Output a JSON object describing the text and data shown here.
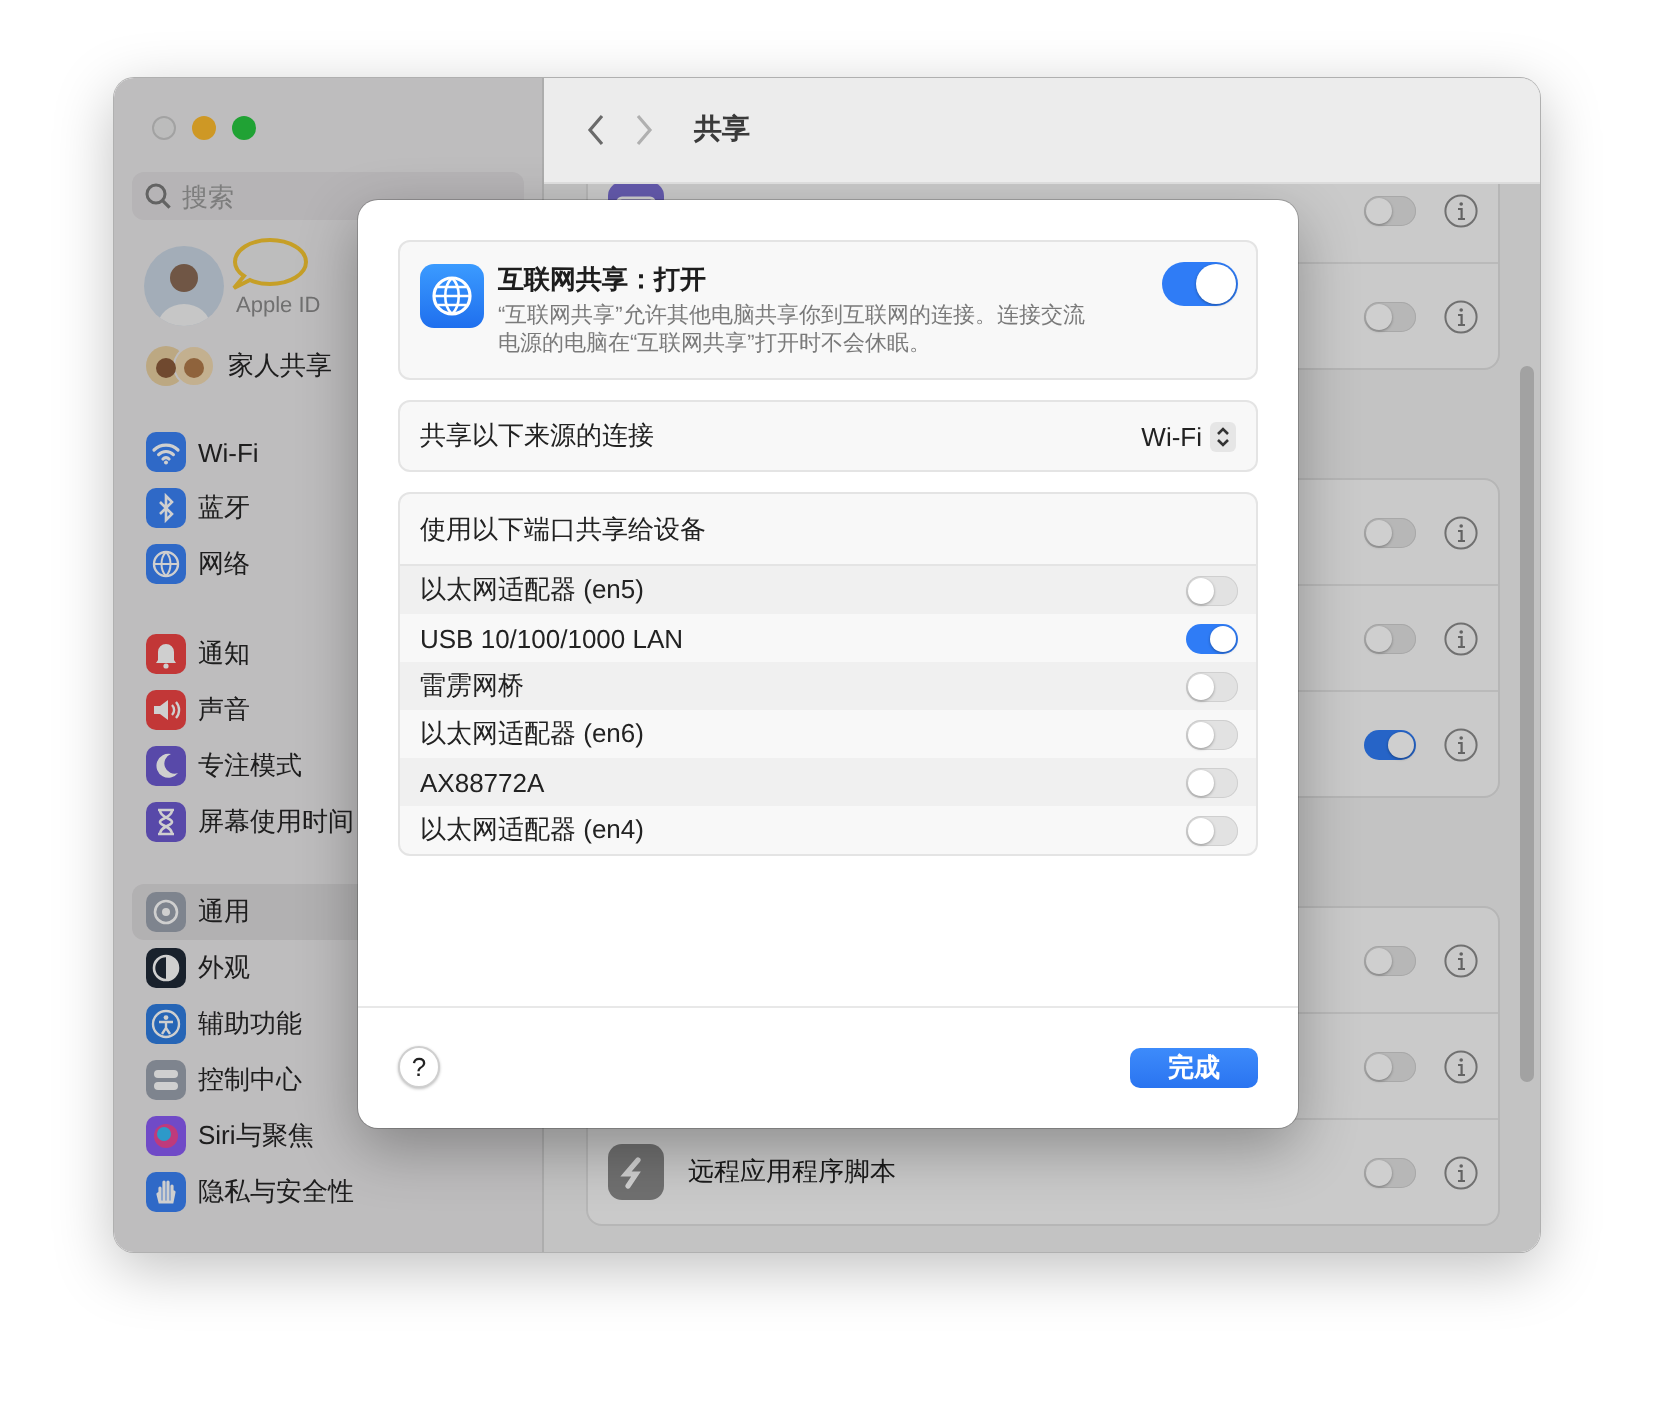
{
  "window": {
    "title": "共享"
  },
  "sidebar": {
    "search": {
      "placeholder": "搜索"
    },
    "account": {
      "label": "Apple ID"
    },
    "family": {
      "label": "家人共享"
    },
    "groups": [
      {
        "items": [
          {
            "label": "Wi-Fi",
            "selected": false
          },
          {
            "label": "蓝牙",
            "selected": false
          },
          {
            "label": "网络",
            "selected": false
          }
        ]
      },
      {
        "items": [
          {
            "label": "通知",
            "selected": false
          },
          {
            "label": "声音",
            "selected": false
          },
          {
            "label": "专注模式",
            "selected": false
          },
          {
            "label": "屏幕使用时间",
            "selected": false
          }
        ]
      },
      {
        "items": [
          {
            "label": "通用",
            "selected": true
          },
          {
            "label": "外观",
            "selected": false
          },
          {
            "label": "辅助功能",
            "selected": false
          },
          {
            "label": "控制中心",
            "selected": false
          },
          {
            "label": "Siri与聚焦",
            "selected": false
          },
          {
            "label": "隐私与安全性",
            "selected": false
          }
        ]
      }
    ]
  },
  "pane": {
    "cards": [
      {
        "rows": [
          {
            "on": false
          },
          {
            "on": false
          }
        ]
      },
      {
        "rows": [
          {
            "on": false
          },
          {
            "on": false
          },
          {
            "on": true
          }
        ]
      },
      {
        "rows": [
          {
            "on": false
          },
          {
            "on": false
          },
          {
            "label": "远程应用程序脚本",
            "on": false
          }
        ]
      }
    ]
  },
  "sheet": {
    "service": {
      "title": "互联网共享：打开",
      "description": "“互联网共享”允许其他电脑共享你到互联网的连接。连接交流电源的电脑在“互联网共享”打开时不会休眠。",
      "on": true
    },
    "source": {
      "label": "共享以下来源的连接",
      "value": "Wi-Fi"
    },
    "ports": {
      "title": "使用以下端口共享给设备",
      "items": [
        {
          "label": "以太网适配器 (en5)",
          "on": false
        },
        {
          "label": "USB 10/100/1000 LAN",
          "on": true
        },
        {
          "label": "雷雳网桥",
          "on": false
        },
        {
          "label": "以太网适配器 (en6)",
          "on": false
        },
        {
          "label": "AX88772A",
          "on": false
        },
        {
          "label": "以太网适配器 (en4)",
          "on": false
        }
      ]
    },
    "help": "?",
    "done": "完成"
  }
}
